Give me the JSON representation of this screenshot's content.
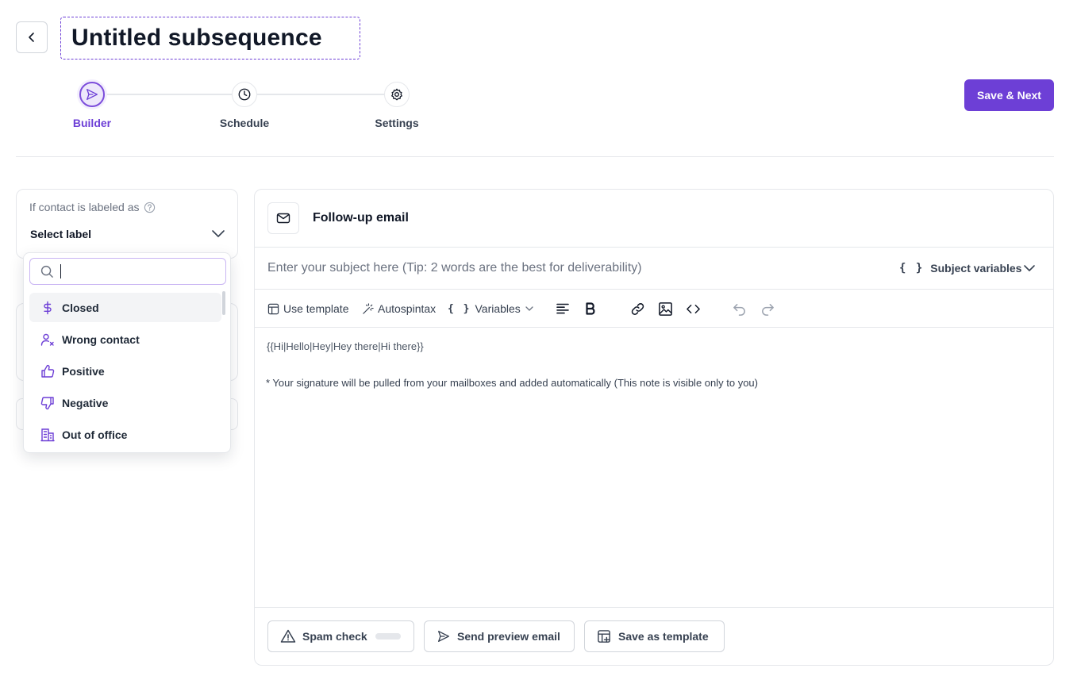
{
  "header": {
    "title": "Untitled subsequence",
    "save_next_label": "Save & Next"
  },
  "stepper": {
    "steps": [
      {
        "label": "Builder",
        "icon": "send-icon",
        "active": true
      },
      {
        "label": "Schedule",
        "icon": "clock-icon",
        "active": false
      },
      {
        "label": "Settings",
        "icon": "gear-icon",
        "active": false
      }
    ]
  },
  "condition": {
    "label": "If contact is labeled as",
    "select_placeholder": "Select label"
  },
  "dropdown": {
    "search_value": "",
    "items": [
      {
        "label": "Closed",
        "icon": "dollar-icon"
      },
      {
        "label": "Wrong contact",
        "icon": "user-x-icon"
      },
      {
        "label": "Positive",
        "icon": "thumbs-up-icon"
      },
      {
        "label": "Negative",
        "icon": "thumbs-down-icon"
      },
      {
        "label": "Out of office",
        "icon": "building-icon"
      }
    ]
  },
  "editor": {
    "title": "Follow-up email",
    "subject_placeholder": "Enter your subject here (Tip: 2 words are the best for deliverability)",
    "subject_variables_label": "Subject variables",
    "toolbar": {
      "use_template": "Use template",
      "autospintax": "Autospintax",
      "variables": "Variables"
    },
    "body_greeting": "{{Hi|Hello|Hey|Hey there|Hi there}}",
    "body_note": "* Your signature will be pulled from your mailboxes and added automatically (This note is visible only to you)"
  },
  "footer": {
    "spam_check": "Spam check",
    "send_preview": "Send preview email",
    "save_template": "Save as template"
  },
  "colors": {
    "accent": "#6d3fd6",
    "accent_light": "#ede7fb",
    "border": "#e5e7eb",
    "text": "#111827",
    "muted": "#6b7280"
  }
}
